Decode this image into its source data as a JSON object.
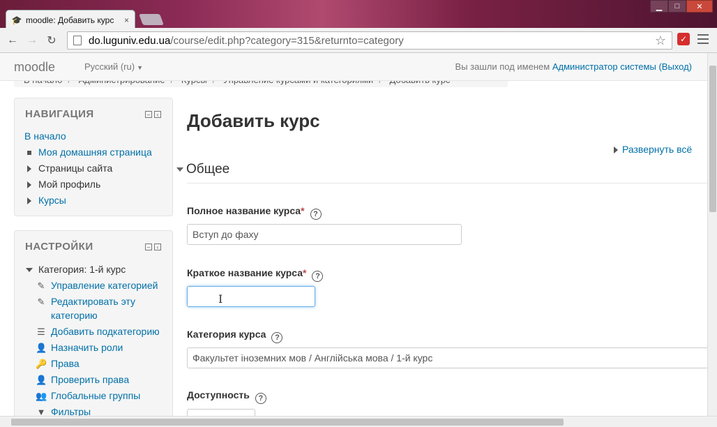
{
  "browser": {
    "tab_title": "moodle: Добавить курс",
    "tab_close": "×",
    "url_host": "do.luguniv.edu.ua",
    "url_path": "/course/edit.php?category=315&returnto=category",
    "back": "←",
    "forward": "→",
    "reload": "↻",
    "star": "☆",
    "minimize": "▁",
    "maximize": "□",
    "close": "✕"
  },
  "header": {
    "brand": "moodle",
    "language": "Русский (ru)",
    "login_prefix": "Вы зашли под именем ",
    "user_name": "Администратор системы",
    "logout": "(Выход)"
  },
  "breadcrumb": [
    "В начало",
    "Администрирование",
    "Курсы",
    "Управление курсами и категориями",
    "Добавить курс"
  ],
  "navigation": {
    "title": "НАВИГАЦИЯ",
    "items": [
      {
        "label": "В начало"
      },
      {
        "label": "Моя домашняя страница"
      },
      {
        "label": "Страницы сайта"
      },
      {
        "label": "Мой профиль"
      },
      {
        "label": "Курсы"
      }
    ]
  },
  "settings": {
    "title": "НАСТРОЙКИ",
    "category_label": "Категория: 1-й курс",
    "items": [
      {
        "label": "Управление категорией",
        "icon": "pencil-icon"
      },
      {
        "label": "Редактировать эту",
        "label2": "категорию",
        "icon": "pencil-icon"
      },
      {
        "label": "Добавить подкатегорию",
        "icon": "subcategory-icon"
      },
      {
        "label": "Назначить роли",
        "icon": "user-icon"
      },
      {
        "label": "Права",
        "icon": "key-icon"
      },
      {
        "label": "Проверить права",
        "icon": "user-check-icon"
      },
      {
        "label": "Глобальные группы",
        "icon": "users-icon"
      },
      {
        "label": "Фильтры",
        "icon": "filter-icon"
      }
    ]
  },
  "main": {
    "title": "Добавить курс",
    "expand_all": "Развернуть всё",
    "section": "Общее",
    "fields": {
      "fullname_label": "Полное название курса",
      "fullname_value": "Вступ до фаху",
      "shortname_label": "Краткое название курса",
      "shortname_value": "",
      "category_label": "Категория курса",
      "category_value": "Факультет іноземних мов / Англійська мова / 1-й курс",
      "visibility_label": "Доступность"
    },
    "required_mark": "*",
    "help_mark": "?"
  }
}
